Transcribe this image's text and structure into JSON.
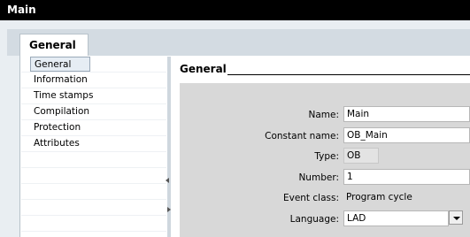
{
  "window": {
    "title": "Main"
  },
  "tab": {
    "label": "General"
  },
  "nav": {
    "items": [
      {
        "label": "General",
        "active": true
      },
      {
        "label": "Information",
        "active": false
      },
      {
        "label": "Time stamps",
        "active": false
      },
      {
        "label": "Compilation",
        "active": false
      },
      {
        "label": "Protection",
        "active": false
      },
      {
        "label": "Attributes",
        "active": false
      }
    ]
  },
  "section": {
    "title": "General"
  },
  "form": {
    "name": {
      "label": "Name:",
      "value": "Main"
    },
    "constant_name": {
      "label": "Constant name:",
      "value": "OB_Main"
    },
    "type": {
      "label": "Type:",
      "value": "OB"
    },
    "number": {
      "label": "Number:",
      "value": "1"
    },
    "event_class": {
      "label": "Event class:",
      "value": "Program cycle"
    },
    "language": {
      "label": "Language:",
      "value": "LAD"
    }
  },
  "icons": {
    "dropdown": "chevron-down-icon",
    "collapse_left": "arrow-left-icon",
    "expand_right": "arrow-right-icon"
  },
  "colors": {
    "titlebar": "#000000",
    "form_bg": "#d8d8d8",
    "panel_bg": "#e9eef2"
  }
}
